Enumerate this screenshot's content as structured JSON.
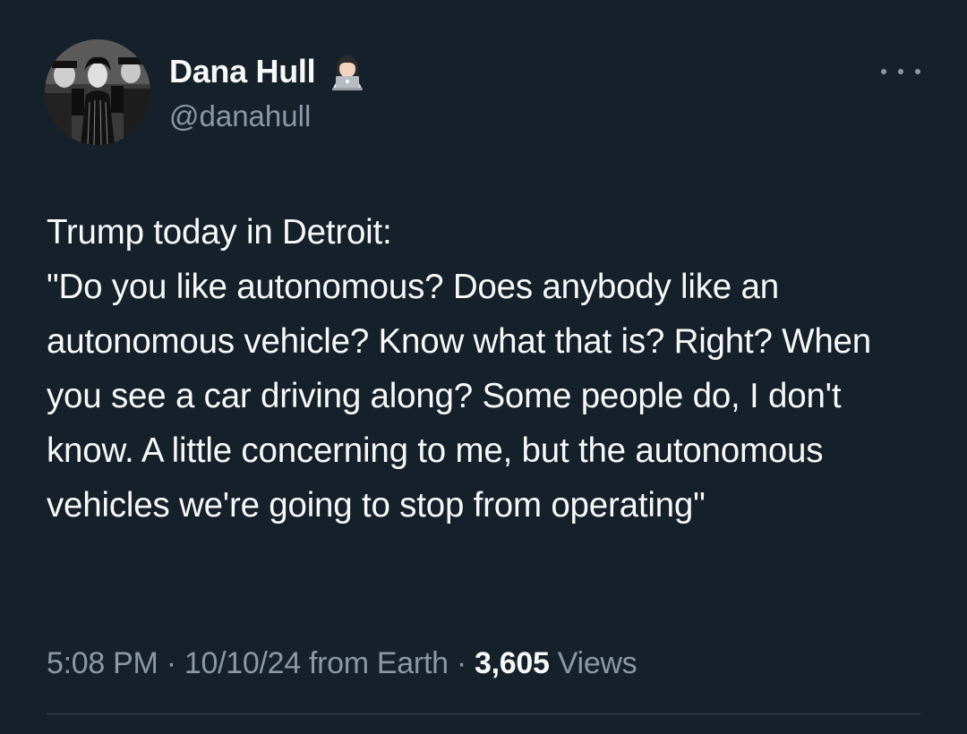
{
  "author": {
    "display_name": "Dana Hull",
    "handle": "@danahull",
    "badge_icon": "technologist-emoji-icon",
    "avatar": "vintage-black-and-white-photo-avatar"
  },
  "menu": {
    "icon": "more-options-icon"
  },
  "tweet": {
    "text": "Trump today in Detroit:\n\"Do you like autonomous? Does anybody like an autonomous vehicle? Know what that is? Right? When you see a car driving along? Some people do, I don't know. A little concerning to me, but the autonomous vehicles we're going to stop from operating\"",
    "time": "5:08 PM",
    "separator": "·",
    "date": "10/10/24",
    "source": "from Earth",
    "views_count": "3,605",
    "views_label": "Views"
  },
  "colors": {
    "background": "#15202b",
    "primary_text": "#f7f9f9",
    "secondary_text": "#8b98a5",
    "divider": "#38444d"
  }
}
